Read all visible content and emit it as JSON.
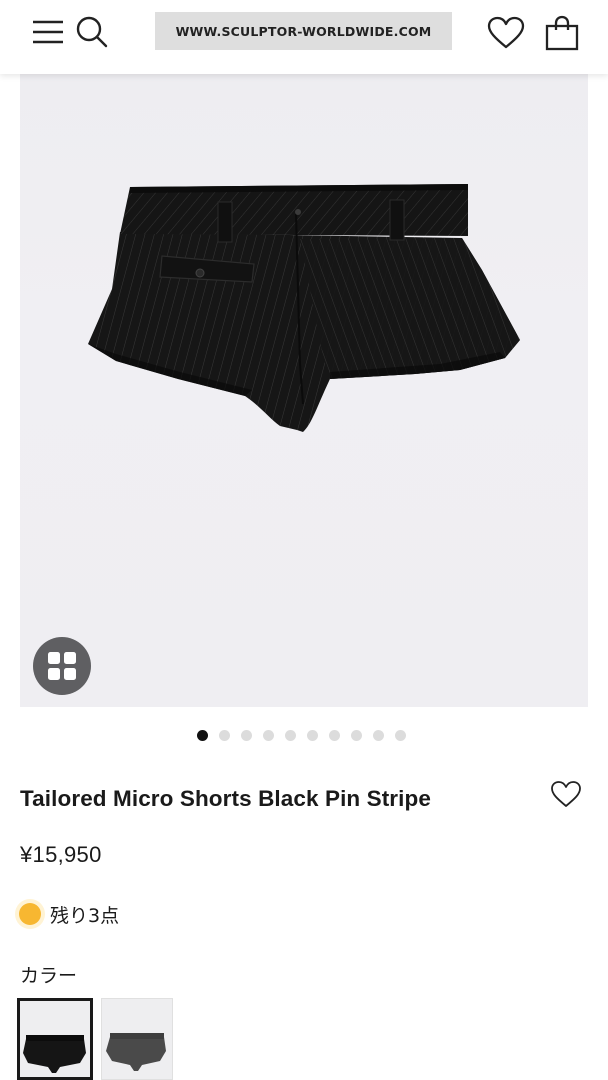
{
  "header": {
    "logo_text": "WWW.SCULPTOR-WORLDWIDE.COM",
    "icons": [
      "menu-icon",
      "search-icon",
      "heart-icon",
      "shopping-bag-icon"
    ]
  },
  "gallery": {
    "total_images": 10,
    "active_index": 0,
    "grid_button_icon": "grid-icon"
  },
  "product": {
    "title": "Tailored Micro Shorts Black Pin Stripe",
    "price": "¥15,950",
    "stock_text": "残り3点",
    "stock_color": "#f7b731",
    "color_label": "カラー",
    "swatches": [
      {
        "color": "#1a1a1a",
        "selected": true
      },
      {
        "color": "#4a4a4a",
        "selected": false
      }
    ]
  }
}
